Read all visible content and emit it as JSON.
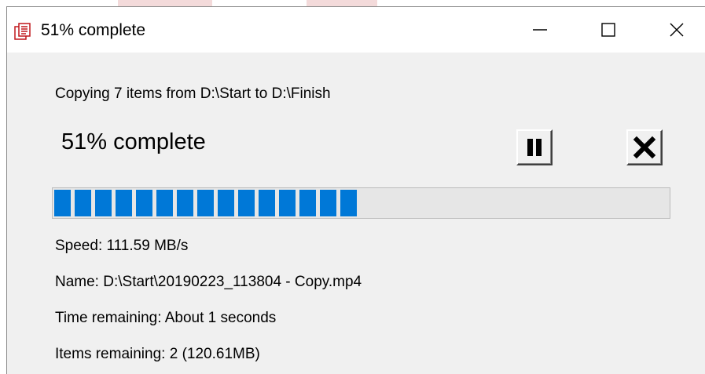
{
  "window": {
    "title": "51% complete",
    "minimize_glyph": "—",
    "maximize_glyph": "☐",
    "close_glyph": "✕"
  },
  "dialog": {
    "copy_line": "Copying 7 items from D:\\Start to D:\\Finish",
    "percent_label": "51% complete",
    "progress_fraction": 0.51,
    "speed": "Speed: 111.59 MB/s",
    "name": "Name: D:\\Start\\20190223_113804 - Copy.mp4",
    "time_remaining": "Time remaining: About 1 seconds",
    "items_remaining": "Items remaining: 2 (120.61MB)"
  },
  "icons": {
    "app": "copy-app-icon",
    "pause": "pause-icon",
    "cancel": "cancel-x-icon"
  },
  "colors": {
    "progress": "#0078d7",
    "window_bg": "#f0f0f0",
    "titlebar_bg": "#ffffff",
    "app_icon_red": "#c0171b"
  }
}
